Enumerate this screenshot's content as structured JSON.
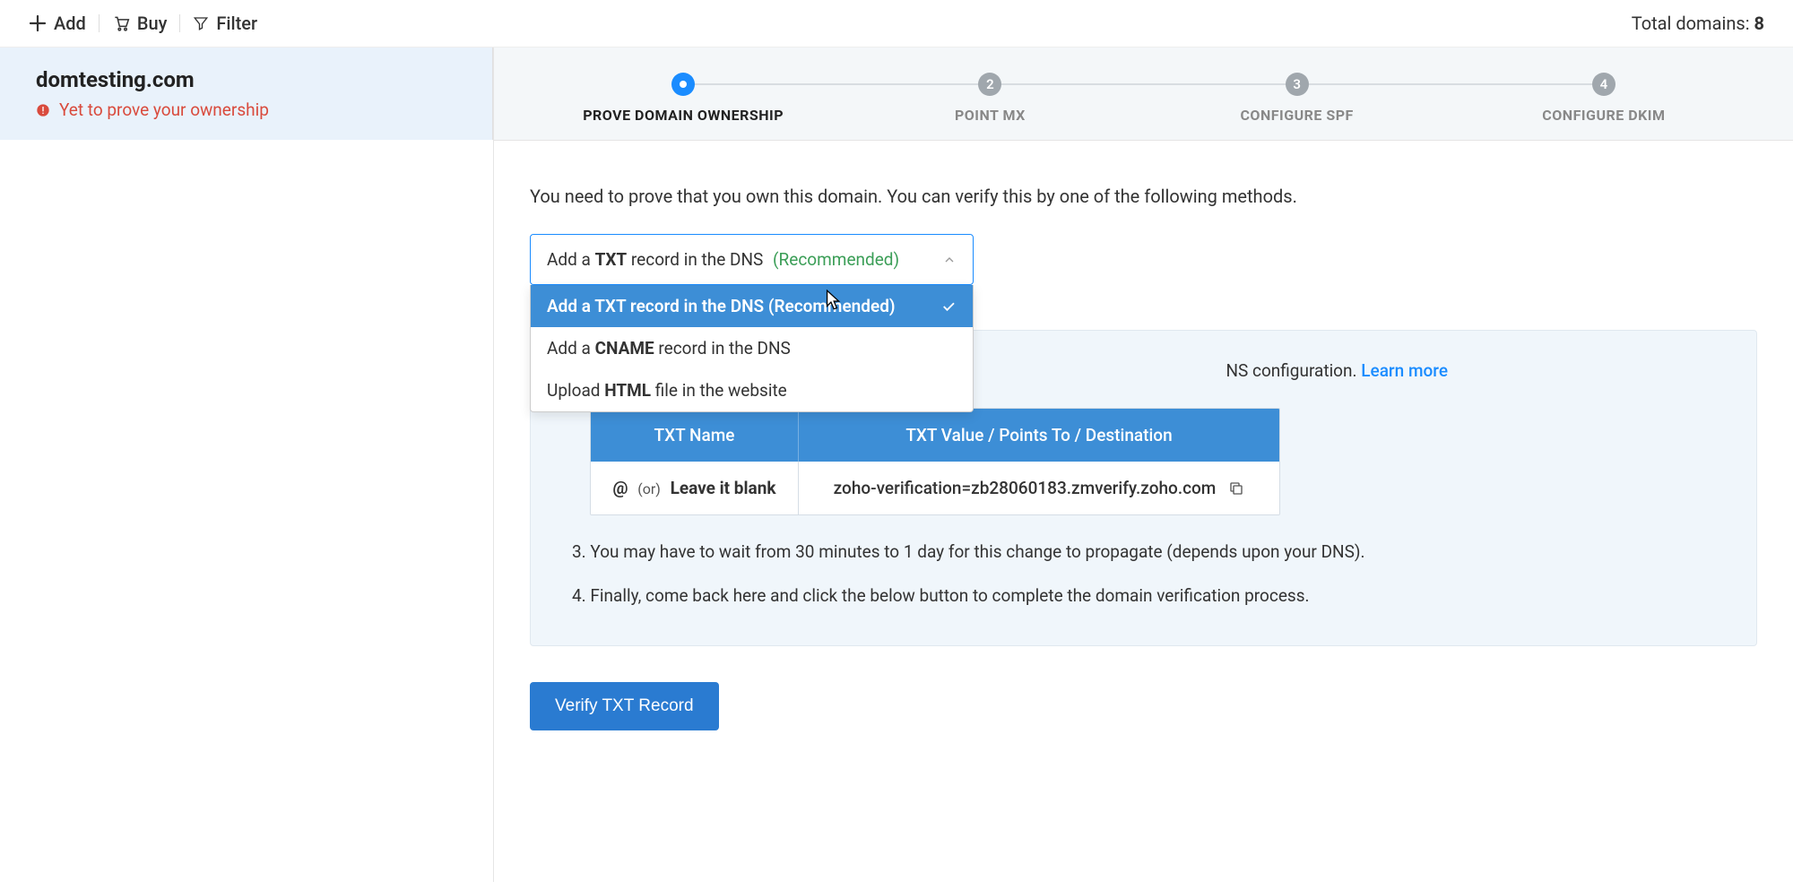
{
  "toolbar": {
    "add": "Add",
    "buy": "Buy",
    "filter": "Filter",
    "total_label": "Total domains: ",
    "total_count": "8"
  },
  "domain": {
    "name": "domtesting.com",
    "status": "Yet to prove your ownership"
  },
  "stepper": {
    "s1": "PROVE DOMAIN OWNERSHIP",
    "s2": "POINT MX",
    "s3": "CONFIGURE SPF",
    "s4": "CONFIGURE DKIM",
    "n2": "2",
    "n3": "3",
    "n4": "4"
  },
  "intro": "You need to prove that you own this domain. You can verify this by one of the following methods.",
  "dropdown": {
    "selected_pre": "Add a ",
    "selected_bold": "TXT",
    "selected_post": " record in the DNS",
    "selected_tag": "(Recommended)",
    "opt1": "Add a TXT record in the DNS (Recommended)",
    "opt2_pre": "Add a ",
    "opt2_bold": "CNAME",
    "opt2_post": " record in the DNS",
    "opt3_pre": "Upload ",
    "opt3_bold": "HTML",
    "opt3_post": " file in the website"
  },
  "panel": {
    "partial": "NS configuration. ",
    "learn": "Learn more",
    "txt_name_h": "TXT Name",
    "txt_value_h": "TXT Value / Points To / Destination",
    "at": "@",
    "or": "(or)",
    "blank": "Leave it blank",
    "txt_value": "zoho-verification=zb28060183.zmverify.zoho.com",
    "instr3": "3. You may have to wait from 30 minutes to 1 day for this change to propagate (depends upon your DNS).",
    "instr4": "4. Finally, come back here and click the below button to complete the domain verification process."
  },
  "verify_btn": "Verify TXT Record"
}
